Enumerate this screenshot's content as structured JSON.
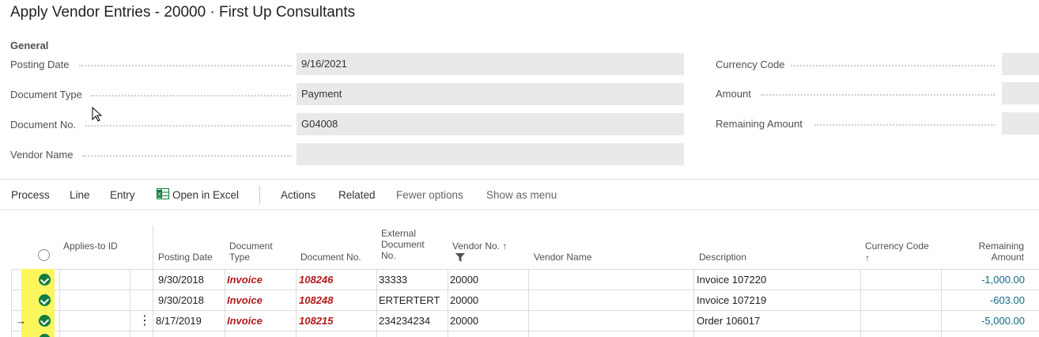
{
  "page": {
    "title": "Apply Vendor Entries - 20000 · First Up Consultants"
  },
  "general": {
    "section_title": "General",
    "posting_date": {
      "label": "Posting Date",
      "value": "9/16/2021"
    },
    "document_type": {
      "label": "Document Type",
      "value": "Payment"
    },
    "document_no": {
      "label": "Document No.",
      "value": "G04008"
    },
    "vendor_name": {
      "label": "Vendor Name",
      "value": ""
    },
    "currency_code": {
      "label": "Currency Code",
      "value": ""
    },
    "amount": {
      "label": "Amount",
      "value": ""
    },
    "remaining_amount": {
      "label": "Remaining Amount",
      "value": ""
    }
  },
  "actions": {
    "process": "Process",
    "line": "Line",
    "entry": "Entry",
    "open_in_excel": "Open in Excel",
    "actions": "Actions",
    "related": "Related",
    "fewer_options": "Fewer options",
    "show_as_menu": "Show as menu"
  },
  "table": {
    "headers": {
      "applies_to_id": "Applies-to ID",
      "posting_date": "Posting Date",
      "document_type": "Document Type",
      "document_no": "Document No.",
      "external_document_no": "External Document No.",
      "vendor_no": "Vendor No.",
      "vendor_name": "Vendor Name",
      "description": "Description",
      "currency_code": "Currency Code",
      "remaining_amount": "Remaining Amount"
    },
    "sort_up_glyph": "↑",
    "row_arrow": "→",
    "row_menu": "⋮",
    "rows": [
      {
        "posting_date": "9/30/2018",
        "document_type": "Invoice",
        "document_no": "108246",
        "external_document_no": "33333",
        "vendor_no": "20000",
        "vendor_name": "",
        "description": "Invoice 107220",
        "currency_code": "",
        "remaining_amount": "-1,000.00"
      },
      {
        "posting_date": "9/30/2018",
        "document_type": "Invoice",
        "document_no": "108248",
        "external_document_no": "ERTERTERT",
        "vendor_no": "20000",
        "vendor_name": "",
        "description": "Invoice 107219",
        "currency_code": "",
        "remaining_amount": "-603.00"
      },
      {
        "posting_date": "8/17/2019",
        "document_type": "Invoice",
        "document_no": "108215",
        "external_document_no": "234234234",
        "vendor_no": "20000",
        "vendor_name": "",
        "description": "Order 106017",
        "currency_code": "",
        "remaining_amount": "-5,000.00"
      }
    ]
  },
  "colors": {
    "accent_green": "#107c41",
    "highlight_yellow": "#fbf55e",
    "link_teal": "#0e6b83",
    "invoice_red": "#b11a1a"
  }
}
